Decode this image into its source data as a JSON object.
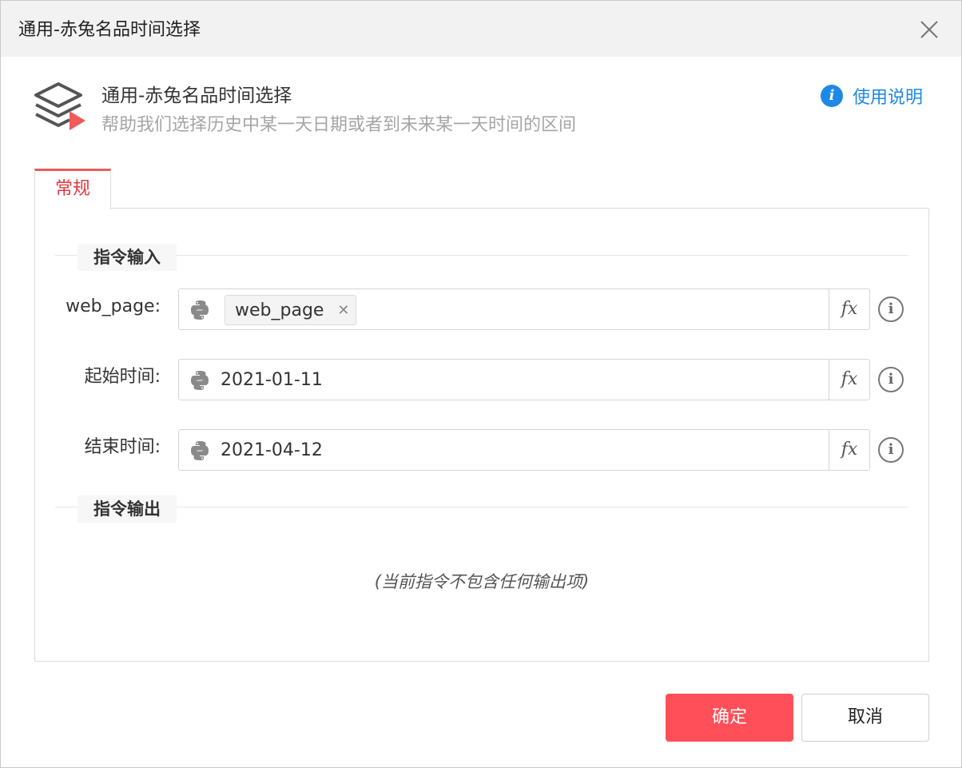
{
  "window": {
    "title": "通用-赤兔名品时间选择"
  },
  "header": {
    "title": "通用-赤兔名品时间选择",
    "description": "帮助我们选择历史中某一天日期或者到未来某一天时间的区间",
    "help_label": "使用说明",
    "help_icon": "info-circle-icon",
    "help_color": "#1e88e5"
  },
  "tabs": [
    {
      "label": "常规",
      "active": true
    }
  ],
  "input_section": {
    "label": "指令输入",
    "fields": [
      {
        "label": "web_page:",
        "value": "web_page",
        "kind": "tag"
      },
      {
        "label": "起始时间:",
        "value": "2021-01-11",
        "kind": "text"
      },
      {
        "label": "结束时间:",
        "value": "2021-04-12",
        "kind": "text"
      }
    ],
    "fx_label": "fx"
  },
  "output_section": {
    "label": "指令输出",
    "empty_text": "(当前指令不包含任何输出项)"
  },
  "buttons": {
    "ok_label": "确定",
    "cancel_label": "取消",
    "ok_color": "#ff4f58"
  },
  "accent_color": "#e85c5c"
}
